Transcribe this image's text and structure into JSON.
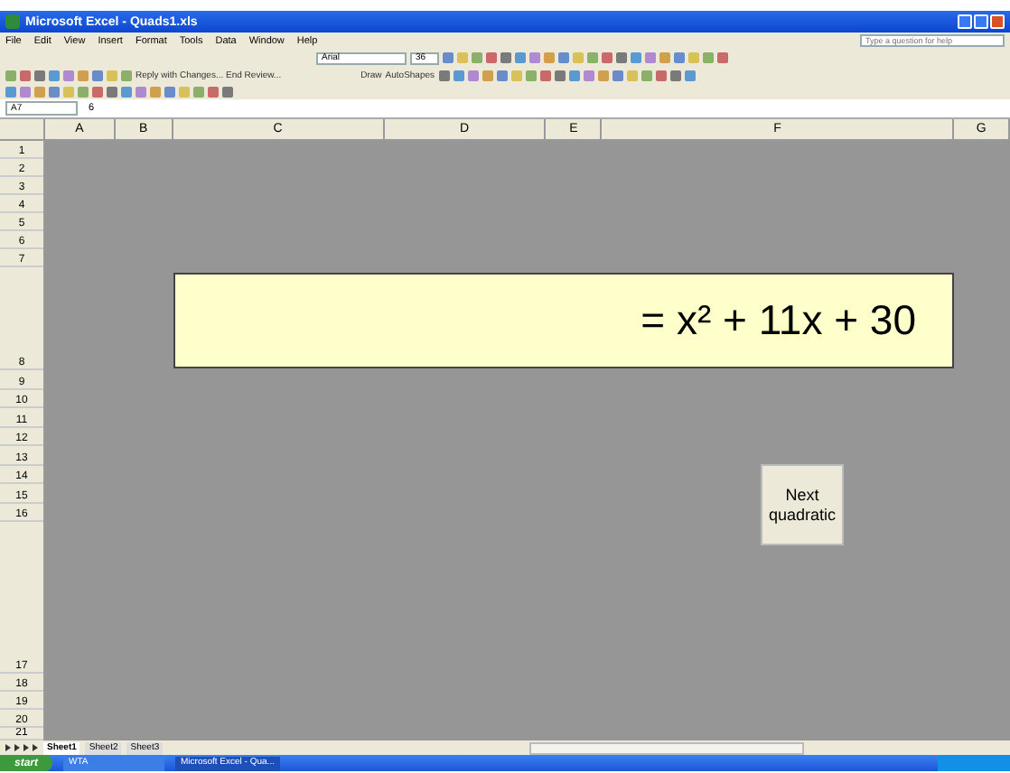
{
  "window": {
    "title": "Microsoft Excel - Quads1.xls"
  },
  "menu": [
    "File",
    "Edit",
    "View",
    "Insert",
    "Format",
    "Tools",
    "Data",
    "Window",
    "Help"
  ],
  "help_box": {
    "placeholder": "Type a question for help"
  },
  "toolbar": {
    "font": "Arial",
    "size": "36",
    "review": "Reply with Changes... End Review...",
    "draw": "Draw",
    "autoshapes": "AutoShapes"
  },
  "formula_bar": {
    "name_box": "A7",
    "value": "6"
  },
  "columns": [
    "A",
    "B",
    "C",
    "D",
    "E",
    "F",
    "G"
  ],
  "rows": [
    "1",
    "2",
    "3",
    "4",
    "5",
    "6",
    "7",
    "8",
    "9",
    "10",
    "11",
    "12",
    "13",
    "14",
    "15",
    "16",
    "17",
    "18",
    "19",
    "20",
    "21"
  ],
  "equation": "= x² + 11x + 30",
  "button": "Next quadratic",
  "sheet_tabs": [
    {
      "label": "Sheet1",
      "selected": true
    },
    {
      "label": "Sheet2",
      "selected": false
    },
    {
      "label": "Sheet3",
      "selected": false
    }
  ],
  "taskbar": {
    "start": "start",
    "items": [
      {
        "label": "WTA",
        "selected": false
      },
      {
        "label": "Microsoft Excel - Qua...",
        "selected": true
      }
    ]
  }
}
